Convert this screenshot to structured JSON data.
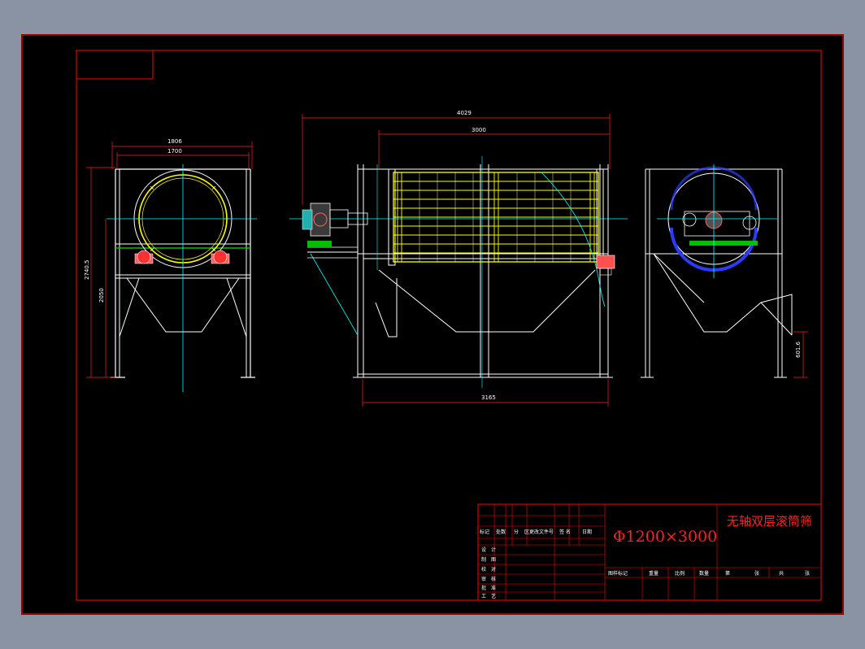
{
  "colors": {
    "background": "#000000",
    "border": "#ff0000",
    "frame": "#ffffff",
    "drum": "#ffff00",
    "centerline": "#00ffff",
    "motor": "#ff6060",
    "rail": "#00c000",
    "cover": "#2a3cff"
  },
  "dimensions": {
    "side_outer_width": "1806",
    "side_inner_width": "1700",
    "side_total_height": "2740.5",
    "side_support_height": "2050",
    "front_total_length": "4029",
    "front_drum_length": "3000",
    "front_base_length": "3165",
    "right_outlet_height": "601.6"
  },
  "title_block": {
    "spec": "Φ1200×3000",
    "name": "无轴双层滚筒筛",
    "header_cells": [
      "标记",
      "处数",
      "分",
      "区更改文件号",
      "签 名",
      "日期"
    ],
    "left_rows": [
      "设　计",
      "制　图",
      "校　对",
      "审　核",
      "批　准",
      "工　艺"
    ],
    "bottom_cells": [
      "图样标记",
      "重量",
      "比例",
      "数量"
    ],
    "sheet_cells": [
      "第",
      "张",
      "共",
      "张"
    ]
  }
}
